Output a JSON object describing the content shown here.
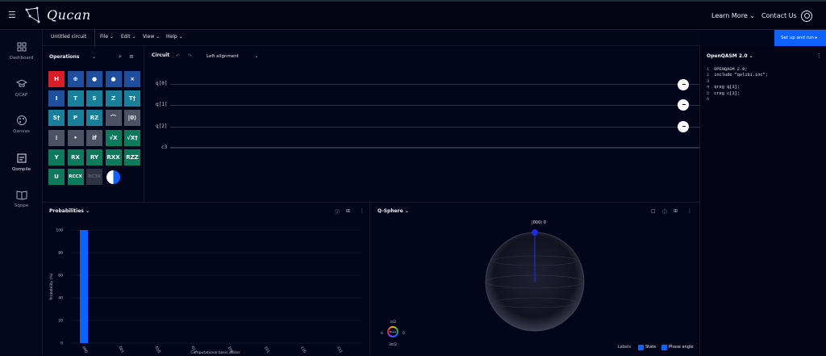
{
  "header": {
    "brand": "Qucan",
    "nav": [
      "Learn More",
      "Contact Us"
    ]
  },
  "sidebar": {
    "items": [
      {
        "label": "Dashboard",
        "icon": "grid-icon"
      },
      {
        "label": "QCAP",
        "icon": "graduation-cap-icon"
      },
      {
        "label": "Qanvas",
        "icon": "palette-icon"
      },
      {
        "label": "Qompile",
        "icon": "compile-icon"
      },
      {
        "label": "Sqope",
        "icon": "book-icon"
      }
    ],
    "active": "Qompile"
  },
  "menubar": {
    "circuit_name": "Untitled circuit",
    "menus": [
      "File",
      "Edit",
      "View",
      "Help"
    ],
    "run_button": "Set up and run"
  },
  "operations": {
    "title": "Operations",
    "gates": [
      [
        "H",
        "⊕",
        "●",
        "●",
        "⨯"
      ],
      [
        "I",
        "T",
        "S",
        "Z",
        "T†"
      ],
      [
        "S†",
        "P",
        "RZ",
        "⌒",
        "|0⟩"
      ],
      [
        "⁞",
        "•",
        "if",
        "√X",
        "√X†"
      ],
      [
        "Y",
        "RX",
        "RY",
        "RXX",
        "RZZ"
      ],
      [
        "U",
        "RCCX",
        "RC3X",
        "◐"
      ]
    ]
  },
  "circuit": {
    "title": "Circuit",
    "alignment": "Left alignment",
    "wires": [
      "q[0]",
      "q[1]",
      "q[2]",
      "c3"
    ]
  },
  "qasm": {
    "title": "OpenQASM 2.0",
    "lines": [
      "OPENQASM 2.0;",
      "include \"qelib1.inc\";",
      "",
      "qreg q[3];",
      "creg c[3];",
      ""
    ]
  },
  "probabilities": {
    "title": "Probabilities",
    "chart_data": {
      "type": "bar",
      "categories": [
        "000",
        "001",
        "010",
        "011",
        "100",
        "101",
        "110",
        "111"
      ],
      "values": [
        100,
        0,
        0,
        0,
        0,
        0,
        0,
        0
      ],
      "xlabel": "Computational basis states",
      "ylabel": "Probability (%)",
      "ylim": [
        0,
        100
      ],
      "yticks": [
        0,
        20,
        40,
        60,
        80,
        100
      ],
      "color": "#0f62fe"
    }
  },
  "qsphere": {
    "title": "Q-Sphere",
    "state_label": "|000⟩ 0",
    "phase_labels": {
      "top": "π/2",
      "bottom": "3π/2",
      "left": "π",
      "right": "0",
      "center": "Phase"
    },
    "labels_title": "Labels",
    "checkboxes": [
      "State",
      "Phase angle"
    ]
  },
  "colors": {
    "accent": "#0f62fe",
    "background": "#03051a",
    "gate_red": "#da1e28",
    "gate_blue": "#1f4e9d",
    "gate_teal": "#1a7f9b",
    "gate_green": "#0e7a5c",
    "gate_gray": "#4d5164"
  }
}
